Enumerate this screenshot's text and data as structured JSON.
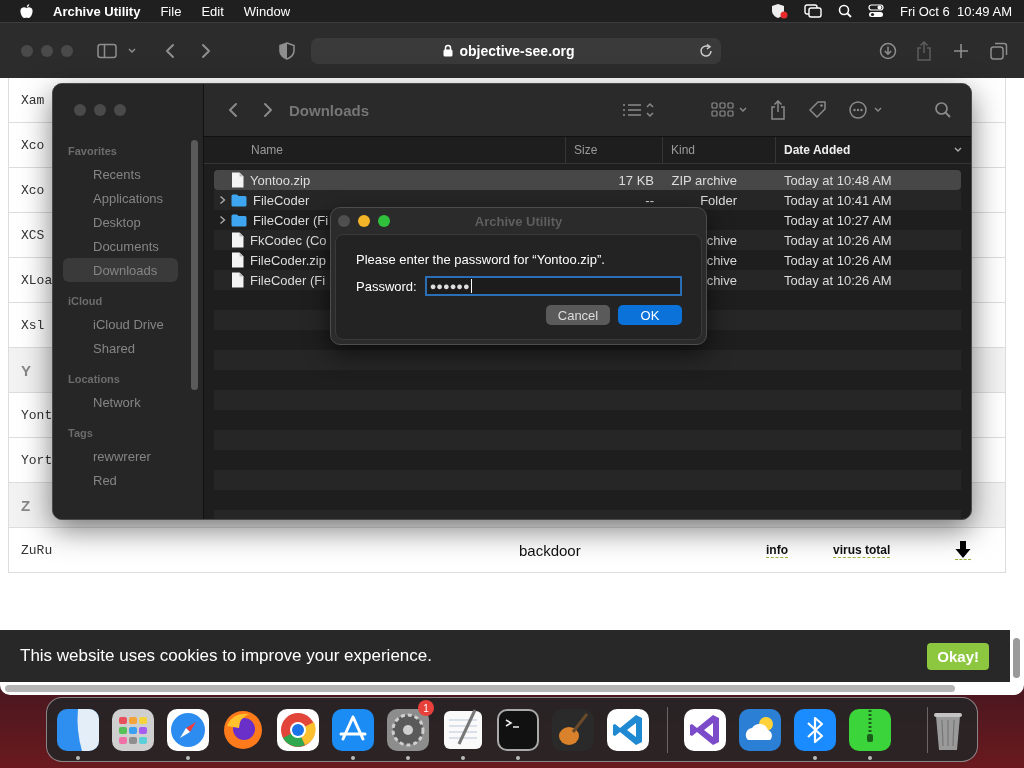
{
  "menu_bar": {
    "app_name": "Archive Utility",
    "menus": [
      "File",
      "Edit",
      "Window"
    ],
    "date": "Fri Oct 6",
    "time": "10:49 AM"
  },
  "browser": {
    "address": "objective-see.org"
  },
  "page": {
    "rows": [
      {
        "kind": "entry",
        "name": "Xam"
      },
      {
        "kind": "entry",
        "name": "Xco"
      },
      {
        "kind": "entry",
        "name": "Xco"
      },
      {
        "kind": "entry",
        "name": "XCS"
      },
      {
        "kind": "entry",
        "name": "XLoa"
      },
      {
        "kind": "entry",
        "name": "Xsl"
      },
      {
        "kind": "section",
        "name": "Y"
      },
      {
        "kind": "entry",
        "name": "Yont"
      },
      {
        "kind": "entry",
        "name": "Yort"
      },
      {
        "kind": "section",
        "name": "Z"
      },
      {
        "kind": "entry",
        "name": "ZuRu",
        "type": "backdoor",
        "info": "info",
        "virus_total": "virus total"
      }
    ],
    "cookie_banner": {
      "message": "This website uses cookies to improve your experience.",
      "button": "Okay!"
    }
  },
  "finder": {
    "title": "Downloads",
    "sidebar": [
      {
        "heading": "Favorites",
        "items": [
          {
            "label": "Recents",
            "selected": false
          },
          {
            "label": "Applications",
            "selected": false
          },
          {
            "label": "Desktop",
            "selected": false
          },
          {
            "label": "Documents",
            "selected": false
          },
          {
            "label": "Downloads",
            "selected": true
          }
        ]
      },
      {
        "heading": "iCloud",
        "items": [
          {
            "label": "iCloud Drive",
            "selected": false
          },
          {
            "label": "Shared",
            "selected": false
          }
        ]
      },
      {
        "heading": "Locations",
        "items": [
          {
            "label": "Network",
            "selected": false
          }
        ]
      },
      {
        "heading": "Tags",
        "items": [
          {
            "label": "rewwrerer",
            "selected": false
          },
          {
            "label": "Red",
            "selected": false
          }
        ]
      }
    ],
    "columns": [
      {
        "label": "Name",
        "sorted": false
      },
      {
        "label": "Size",
        "sorted": false
      },
      {
        "label": "Kind",
        "sorted": false
      },
      {
        "label": "Date Added",
        "sorted": true
      }
    ],
    "files": [
      {
        "kind": "file",
        "name": "Yontoo.zip",
        "size": "17 KB",
        "file_type": "ZIP archive",
        "date_added": "Today at 10:48 AM",
        "selected": true
      },
      {
        "kind": "folder",
        "name": "FileCoder",
        "size": "--",
        "file_type": "Folder",
        "date_added": "Today at 10:41 AM",
        "selected": false
      },
      {
        "kind": "folder",
        "name": "FileCoder (Fi",
        "date_added": "Today at 10:27 AM",
        "selected": false
      },
      {
        "kind": "file",
        "name": "FkCodec (Co",
        "file_type": "chive",
        "date_added": "Today at 10:26 AM",
        "selected": false
      },
      {
        "kind": "file",
        "name": "FileCoder.zip",
        "file_type": "chive",
        "date_added": "Today at 10:26 AM",
        "selected": false
      },
      {
        "kind": "file",
        "name": "FileCoder (Fi",
        "file_type": "chive",
        "date_added": "Today at 10:26 AM",
        "selected": false
      }
    ]
  },
  "dialog": {
    "title": "Archive Utility",
    "message": "Please enter the password for “Yontoo.zip”.",
    "field_label": "Password:",
    "password": "●●●●●●",
    "buttons": [
      {
        "label": "Cancel",
        "default": false
      },
      {
        "label": "OK",
        "default": true
      }
    ]
  },
  "dock": {
    "items": [
      {
        "running": true
      },
      {
        "running": false
      },
      {
        "running": true
      },
      {
        "running": false
      },
      {
        "running": false
      },
      {
        "running": true
      },
      {
        "running": true,
        "badge": "1"
      },
      {
        "running": true
      },
      {
        "running": true
      },
      {
        "running": false
      },
      {
        "running": false
      },
      {
        "running": false
      },
      {
        "running": false
      },
      {
        "running": true
      },
      {
        "running": true
      },
      {
        "running": false
      }
    ]
  }
}
